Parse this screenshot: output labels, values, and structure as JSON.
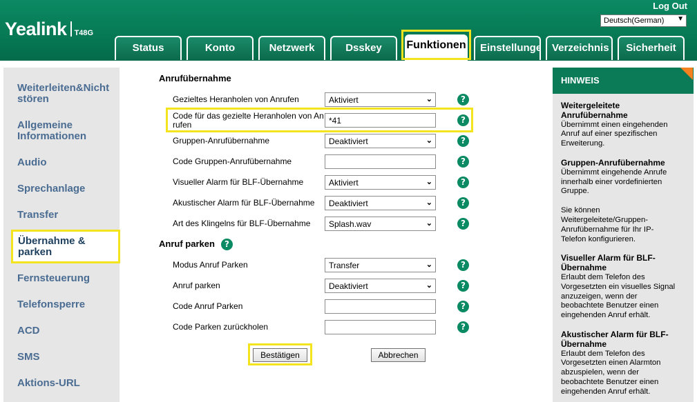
{
  "header": {
    "brand": "Yealink",
    "model": "T48G",
    "logout": "Log Out",
    "language": "Deutsch(German)"
  },
  "tabs": [
    {
      "label": "Status"
    },
    {
      "label": "Konto"
    },
    {
      "label": "Netzwerk"
    },
    {
      "label": "Dsskey"
    },
    {
      "label": "Funktionen"
    },
    {
      "label": "Einstellungen"
    },
    {
      "label": "Verzeichnis"
    },
    {
      "label": "Sicherheit"
    }
  ],
  "sidebar": {
    "items": [
      {
        "label": "Weiterleiten&Nicht stören"
      },
      {
        "label": "Allgemeine Informationen"
      },
      {
        "label": "Audio"
      },
      {
        "label": "Sprechanlage"
      },
      {
        "label": "Transfer"
      },
      {
        "label": "Übernahme & parken"
      },
      {
        "label": "Fernsteuerung"
      },
      {
        "label": "Telefonsperre"
      },
      {
        "label": "ACD"
      },
      {
        "label": "SMS"
      },
      {
        "label": "Aktions-URL"
      }
    ]
  },
  "main": {
    "section1": "Anrufübernahme",
    "rows1": [
      {
        "label": "Gezieltes Heranholen von Anrufen",
        "value": "Aktiviert"
      },
      {
        "label_l1": "Code für das gezielte Heranholen von An",
        "label_l2": "rufen",
        "value": "*41"
      },
      {
        "label": "Gruppen-Anrufübernahme",
        "value": "Deaktiviert"
      },
      {
        "label": "Code Gruppen-Anrufübernahme",
        "value": ""
      },
      {
        "label": "Visueller Alarm für BLF-Übernahme",
        "value": "Aktiviert"
      },
      {
        "label": "Akustischer Alarm für BLF-Übernahme",
        "value": "Deaktiviert"
      },
      {
        "label": "Art des Klingelns für BLF-Übernahme",
        "value": "Splash.wav"
      }
    ],
    "section2": "Anruf parken",
    "rows2": [
      {
        "label": "Modus Anruf Parken",
        "value": "Transfer"
      },
      {
        "label": "Anruf parken",
        "value": "Deaktiviert"
      },
      {
        "label": "Code Anruf Parken",
        "value": ""
      },
      {
        "label": "Code Parken zurückholen",
        "value": ""
      }
    ],
    "confirm": "Bestätigen",
    "cancel": "Abbrechen",
    "help_glyph": "?"
  },
  "hint": {
    "title": "HINWEIS",
    "blocks": [
      {
        "t1": "Weitergeleitete",
        "t2": "Anrufübernahme",
        "body": [
          "Übernimmt einen eingehenden",
          "Anruf auf einer spezifischen",
          "Erweiterung."
        ]
      },
      {
        "t1": "Gruppen-Anrufübernahme",
        "t2": "",
        "body": [
          "Übernimmt eingehende Anrufe",
          "innerhalb einer vordefinierten",
          "Gruppe."
        ]
      },
      {
        "t1": "",
        "t2": "",
        "body": [
          "Sie können",
          "Weitergeleitete/Gruppen-",
          "Anrufübernahme für Ihr IP-",
          "Telefon konfigurieren."
        ]
      },
      {
        "t1": "Visueller Alarm für BLF-",
        "t2": "Übernahme",
        "body": [
          "Erlaubt dem Telefon des",
          "Vorgesetzten ein visuelles Signal",
          "anzuzeigen, wenn der",
          "beobachtete Benutzer einen",
          "eingehenden Anruf erhält."
        ]
      },
      {
        "t1": "Akustischer Alarm für BLF-",
        "t2": "Übernahme",
        "body": [
          "Erlaubt dem Telefon des",
          "Vorgesetzten einen Alarmton",
          "abzuspielen, wenn der",
          "beobachtete Benutzer einen",
          "eingehenden Anruf erhält."
        ]
      }
    ]
  },
  "colors": {
    "brand_green": "#067a55",
    "highlight": "#f4e41e",
    "nav_link": "#4a6c92",
    "hint_corner": "#f5821f"
  }
}
